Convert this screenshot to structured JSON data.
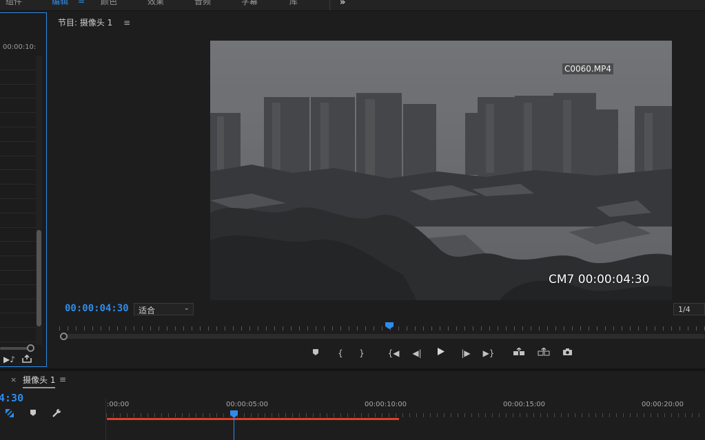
{
  "workspace": {
    "tabs": [
      {
        "label": "组件"
      },
      {
        "label": "编辑"
      },
      {
        "label": "颜色"
      },
      {
        "label": "效果"
      },
      {
        "label": "音频"
      },
      {
        "label": "字幕"
      },
      {
        "label": "库"
      }
    ],
    "menu_glyph": "≡",
    "more": "»"
  },
  "source_panel": {
    "ruler_time": "00:00:10:"
  },
  "program": {
    "title": "节目: 摄像头 1",
    "menu_glyph": "≡",
    "clip_name": "C0060.MP4",
    "burn_timecode": "CM7 00:00:04:30",
    "current_timecode": "00:00:04:30",
    "zoom": "适合",
    "quality": "1/4"
  },
  "timeline": {
    "close": "×",
    "tab_label": "摄像头 1",
    "menu_glyph": "≡",
    "timecode": "4:30",
    "ruler_labels": [
      ":00:00",
      "00:00:05:00",
      "00:00:10:00",
      "00:00:15:00",
      "00:00:20:00"
    ]
  },
  "colors": {
    "accent": "#2d8ceb",
    "work_area": "#e0412a",
    "panel_bg": "#1d1d1d"
  }
}
